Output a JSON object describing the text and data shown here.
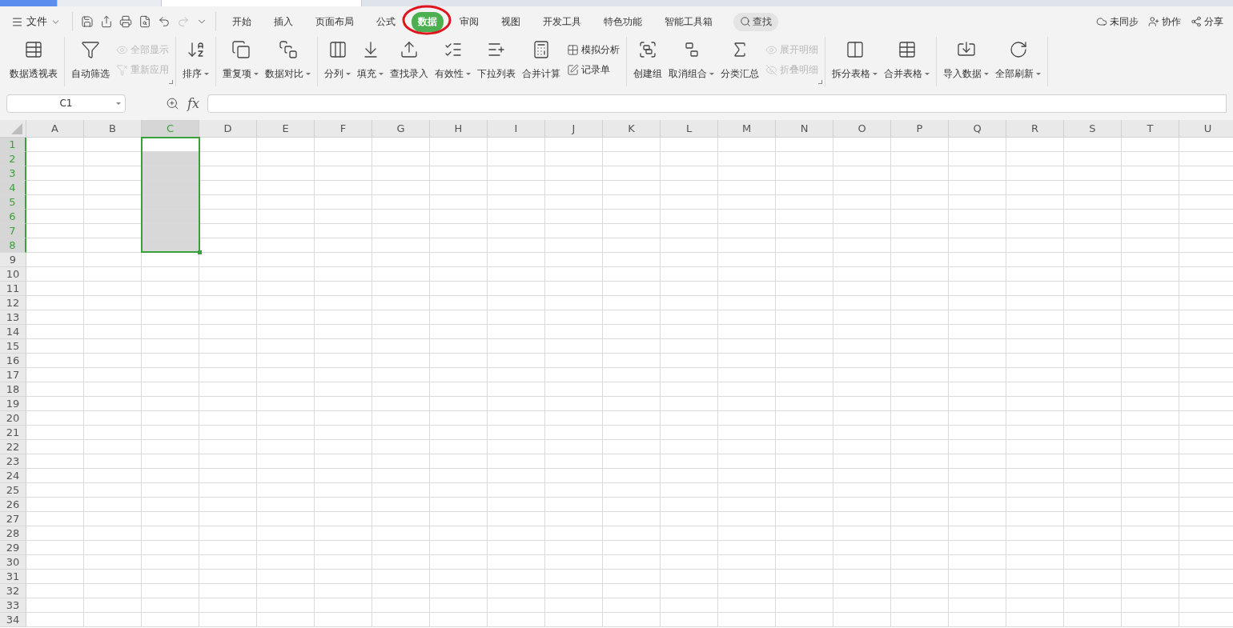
{
  "menu": {
    "file_label": "文件"
  },
  "ribbon_tabs": [
    {
      "label": "开始",
      "selected": false
    },
    {
      "label": "插入",
      "selected": false
    },
    {
      "label": "页面布局",
      "selected": false
    },
    {
      "label": "公式",
      "selected": false
    },
    {
      "label": "数据",
      "selected": true
    },
    {
      "label": "审阅",
      "selected": false
    },
    {
      "label": "视图",
      "selected": false
    },
    {
      "label": "开发工具",
      "selected": false
    },
    {
      "label": "特色功能",
      "selected": false
    },
    {
      "label": "智能工具箱",
      "selected": false
    }
  ],
  "search": {
    "label": "查找"
  },
  "right_actions": [
    {
      "label": "未同步"
    },
    {
      "label": "协作"
    },
    {
      "label": "分享"
    }
  ],
  "ribbon": {
    "groups": [
      {
        "launcher": false,
        "items": [
          {
            "kind": "large",
            "label": "数据透视表",
            "dropdown": false
          }
        ]
      },
      {
        "launcher": true,
        "items": [
          {
            "kind": "large",
            "label": "自动筛选",
            "dropdown": false
          },
          {
            "kind": "stack",
            "items": [
              {
                "label": "全部显示",
                "disabled": true
              },
              {
                "label": "重新应用",
                "disabled": true
              }
            ]
          }
        ]
      },
      {
        "launcher": false,
        "items": [
          {
            "kind": "large",
            "label": "排序",
            "dropdown": true
          }
        ]
      },
      {
        "launcher": false,
        "items": [
          {
            "kind": "large",
            "label": "重复项",
            "dropdown": true
          },
          {
            "kind": "large",
            "label": "数据对比",
            "dropdown": true
          }
        ]
      },
      {
        "launcher": false,
        "items": [
          {
            "kind": "large",
            "label": "分列",
            "dropdown": true
          },
          {
            "kind": "large",
            "label": "填充",
            "dropdown": true
          },
          {
            "kind": "large",
            "label": "查找录入",
            "dropdown": false
          },
          {
            "kind": "large",
            "label": "有效性",
            "dropdown": true
          },
          {
            "kind": "large",
            "label": "下拉列表",
            "dropdown": false
          },
          {
            "kind": "large",
            "label": "合并计算",
            "dropdown": false
          },
          {
            "kind": "stack",
            "items": [
              {
                "label": "模拟分析",
                "disabled": false
              },
              {
                "label": "记录单",
                "disabled": false
              }
            ]
          }
        ]
      },
      {
        "launcher": true,
        "items": [
          {
            "kind": "large",
            "label": "创建组",
            "dropdown": false
          },
          {
            "kind": "large",
            "label": "取消组合",
            "dropdown": true
          },
          {
            "kind": "large",
            "label": "分类汇总",
            "dropdown": false
          },
          {
            "kind": "stack",
            "items": [
              {
                "label": "展开明细",
                "disabled": true
              },
              {
                "label": "折叠明细",
                "disabled": true
              }
            ]
          }
        ]
      },
      {
        "launcher": false,
        "items": [
          {
            "kind": "large",
            "label": "拆分表格",
            "dropdown": true
          },
          {
            "kind": "large",
            "label": "合并表格",
            "dropdown": true
          }
        ]
      },
      {
        "launcher": false,
        "items": [
          {
            "kind": "large",
            "label": "导入数据",
            "dropdown": true
          },
          {
            "kind": "large",
            "label": "全部刷新",
            "dropdown": true
          }
        ]
      }
    ]
  },
  "formula_bar": {
    "name_box": "C1",
    "fx_label": "fx"
  },
  "sheet": {
    "columns": [
      {
        "label": "A",
        "selected": false
      },
      {
        "label": "B",
        "selected": false
      },
      {
        "label": "C",
        "selected": true
      },
      {
        "label": "D",
        "selected": false
      },
      {
        "label": "E",
        "selected": false
      },
      {
        "label": "F",
        "selected": false
      },
      {
        "label": "G",
        "selected": false
      },
      {
        "label": "H",
        "selected": false
      },
      {
        "label": "I",
        "selected": false
      },
      {
        "label": "J",
        "selected": false
      },
      {
        "label": "K",
        "selected": false
      },
      {
        "label": "L",
        "selected": false
      },
      {
        "label": "M",
        "selected": false
      },
      {
        "label": "N",
        "selected": false
      },
      {
        "label": "O",
        "selected": false
      },
      {
        "label": "P",
        "selected": false
      },
      {
        "label": "Q",
        "selected": false
      },
      {
        "label": "R",
        "selected": false
      },
      {
        "label": "S",
        "selected": false
      },
      {
        "label": "T",
        "selected": false
      },
      {
        "label": "U",
        "selected": false
      }
    ],
    "rows": [
      {
        "label": "1",
        "selected": true
      },
      {
        "label": "2",
        "selected": true
      },
      {
        "label": "3",
        "selected": true
      },
      {
        "label": "4",
        "selected": true
      },
      {
        "label": "5",
        "selected": true
      },
      {
        "label": "6",
        "selected": true
      },
      {
        "label": "7",
        "selected": true
      },
      {
        "label": "8",
        "selected": true
      },
      {
        "label": "9",
        "selected": false
      },
      {
        "label": "10",
        "selected": false
      },
      {
        "label": "11",
        "selected": false
      },
      {
        "label": "12",
        "selected": false
      },
      {
        "label": "13",
        "selected": false
      },
      {
        "label": "14",
        "selected": false
      },
      {
        "label": "15",
        "selected": false
      },
      {
        "label": "16",
        "selected": false
      },
      {
        "label": "17",
        "selected": false
      },
      {
        "label": "18",
        "selected": false
      },
      {
        "label": "19",
        "selected": false
      },
      {
        "label": "20",
        "selected": false
      },
      {
        "label": "21",
        "selected": false
      },
      {
        "label": "22",
        "selected": false
      },
      {
        "label": "23",
        "selected": false
      },
      {
        "label": "24",
        "selected": false
      },
      {
        "label": "25",
        "selected": false
      },
      {
        "label": "26",
        "selected": false
      },
      {
        "label": "27",
        "selected": false
      },
      {
        "label": "28",
        "selected": false
      },
      {
        "label": "29",
        "selected": false
      },
      {
        "label": "30",
        "selected": false
      },
      {
        "label": "31",
        "selected": false
      },
      {
        "label": "32",
        "selected": false
      },
      {
        "label": "33",
        "selected": false
      },
      {
        "label": "34",
        "selected": false
      }
    ]
  }
}
